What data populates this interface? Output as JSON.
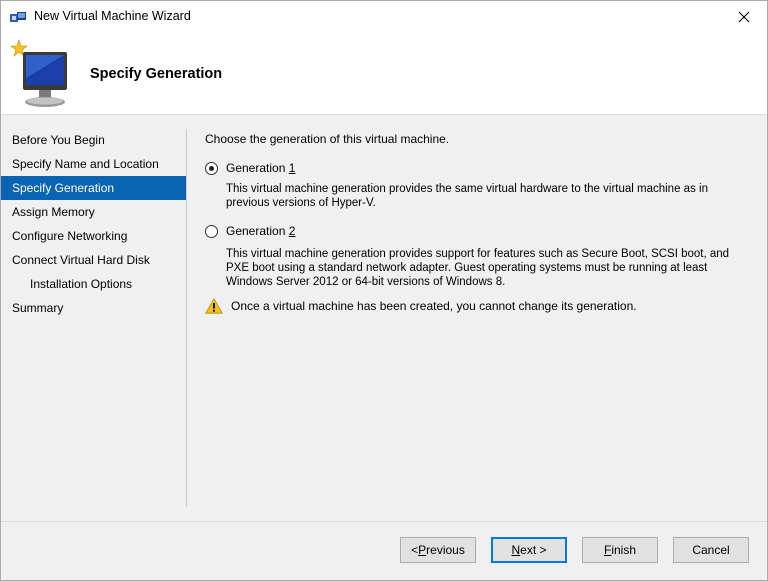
{
  "window": {
    "title": "New Virtual Machine Wizard",
    "close_glyph": "✕"
  },
  "header": {
    "title": "Specify Generation"
  },
  "nav": {
    "items": [
      {
        "label": "Before You Begin",
        "active": false,
        "sub": false
      },
      {
        "label": "Specify Name and Location",
        "active": false,
        "sub": false
      },
      {
        "label": "Specify Generation",
        "active": true,
        "sub": false
      },
      {
        "label": "Assign Memory",
        "active": false,
        "sub": false
      },
      {
        "label": "Configure Networking",
        "active": false,
        "sub": false
      },
      {
        "label": "Connect Virtual Hard Disk",
        "active": false,
        "sub": false
      },
      {
        "label": "Installation Options",
        "active": false,
        "sub": true
      },
      {
        "label": "Summary",
        "active": false,
        "sub": false
      }
    ]
  },
  "content": {
    "intro": "Choose the generation of this virtual machine.",
    "gen1": {
      "label_prefix": "Generation ",
      "label_key": "1",
      "selected": true,
      "description": "This virtual machine generation provides the same virtual hardware to the virtual machine as in previous versions of Hyper-V."
    },
    "gen2": {
      "label_prefix": "Generation ",
      "label_key": "2",
      "selected": false,
      "description": "This virtual machine generation provides support for features such as Secure Boot, SCSI boot, and PXE boot using a standard network adapter. Guest operating systems must be running at least Windows Server 2012 or 64-bit versions of Windows 8."
    },
    "warning": "Once a virtual machine has been created, you cannot change its generation."
  },
  "buttons": {
    "previous": {
      "pre": "< ",
      "key": "P",
      "post": "revious"
    },
    "next": {
      "pre": "",
      "key": "N",
      "post": "ext >"
    },
    "finish": {
      "pre": "",
      "key": "F",
      "post": "inish"
    },
    "cancel": {
      "label": "Cancel"
    }
  },
  "colors": {
    "nav_active_bg": "#0a64b4",
    "default_button_border": "#0078d7",
    "warning_yellow": "#f4c21b"
  },
  "icons": {
    "title": "hyper-v-icon",
    "header": "new-vm-monitor-icon",
    "warning": "warning-icon",
    "close": "close-icon"
  }
}
